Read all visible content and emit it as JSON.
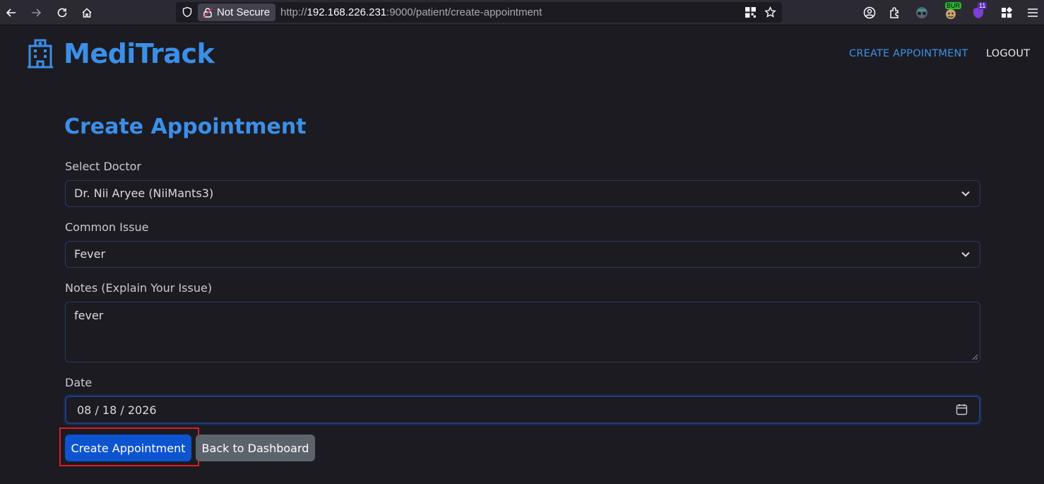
{
  "browser": {
    "not_secure_label": "Not Secure",
    "url_protocol": "http://",
    "url_host": "192.168.226.231",
    "url_rest": ":9000/patient/create-appointment",
    "extension_badges": {
      "bur": "BUR",
      "count": "11"
    }
  },
  "navbar": {
    "brand_name": "MediTrack",
    "brand_icon": "hospital-icon",
    "links": {
      "create": "CREATE APPOINTMENT",
      "logout": "LOGOUT"
    }
  },
  "form": {
    "title": "Create Appointment",
    "doctor": {
      "label": "Select Doctor",
      "value": "Dr. Nii Aryee (NiiMants3)"
    },
    "issue": {
      "label": "Common Issue",
      "value": "Fever"
    },
    "notes": {
      "label": "Notes (Explain Your Issue)",
      "value": "fever"
    },
    "date": {
      "label": "Date",
      "value": "08 / 18 / 2026"
    },
    "submit_label": "Create Appointment",
    "back_label": "Back to Dashboard"
  },
  "colors": {
    "accent": "#3b8fe8",
    "primary_button": "#0d54d1",
    "secondary_button": "#5d636a",
    "background": "#1c1b22",
    "highlight": "#e01b24"
  }
}
